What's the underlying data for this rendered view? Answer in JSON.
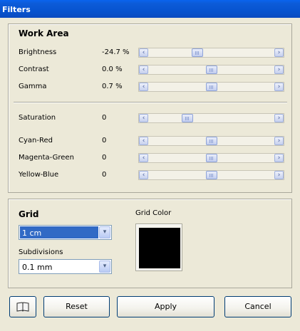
{
  "window": {
    "title": "Filters"
  },
  "work_area": {
    "title": "Work Area",
    "sliders": [
      {
        "label": "Brightness",
        "value": "-24.7 %",
        "level": 0.38
      },
      {
        "label": "Contrast",
        "value": "0.0 %",
        "level": 0.5
      },
      {
        "label": "Gamma",
        "value": "0.7 %",
        "level": 0.5
      }
    ],
    "color_sliders": [
      {
        "label": "Saturation",
        "value": "0",
        "level": 0.29
      },
      {
        "label": "Cyan-Red",
        "value": "0",
        "level": 0.5
      },
      {
        "label": "Magenta-Green",
        "value": "0",
        "level": 0.5
      },
      {
        "label": "Yellow-Blue",
        "value": "0",
        "level": 0.5
      }
    ]
  },
  "grid": {
    "title": "Grid",
    "size_value": "1 cm",
    "subdivisions_label": "Subdivisions",
    "subdivisions_value": "0.1 mm",
    "color_label": "Grid Color",
    "color": "#000000"
  },
  "buttons": {
    "reset": "Reset",
    "apply": "Apply",
    "cancel": "Cancel"
  },
  "icons": {
    "left_arrow": "‹",
    "right_arrow": "›",
    "dropdown": "▾"
  }
}
